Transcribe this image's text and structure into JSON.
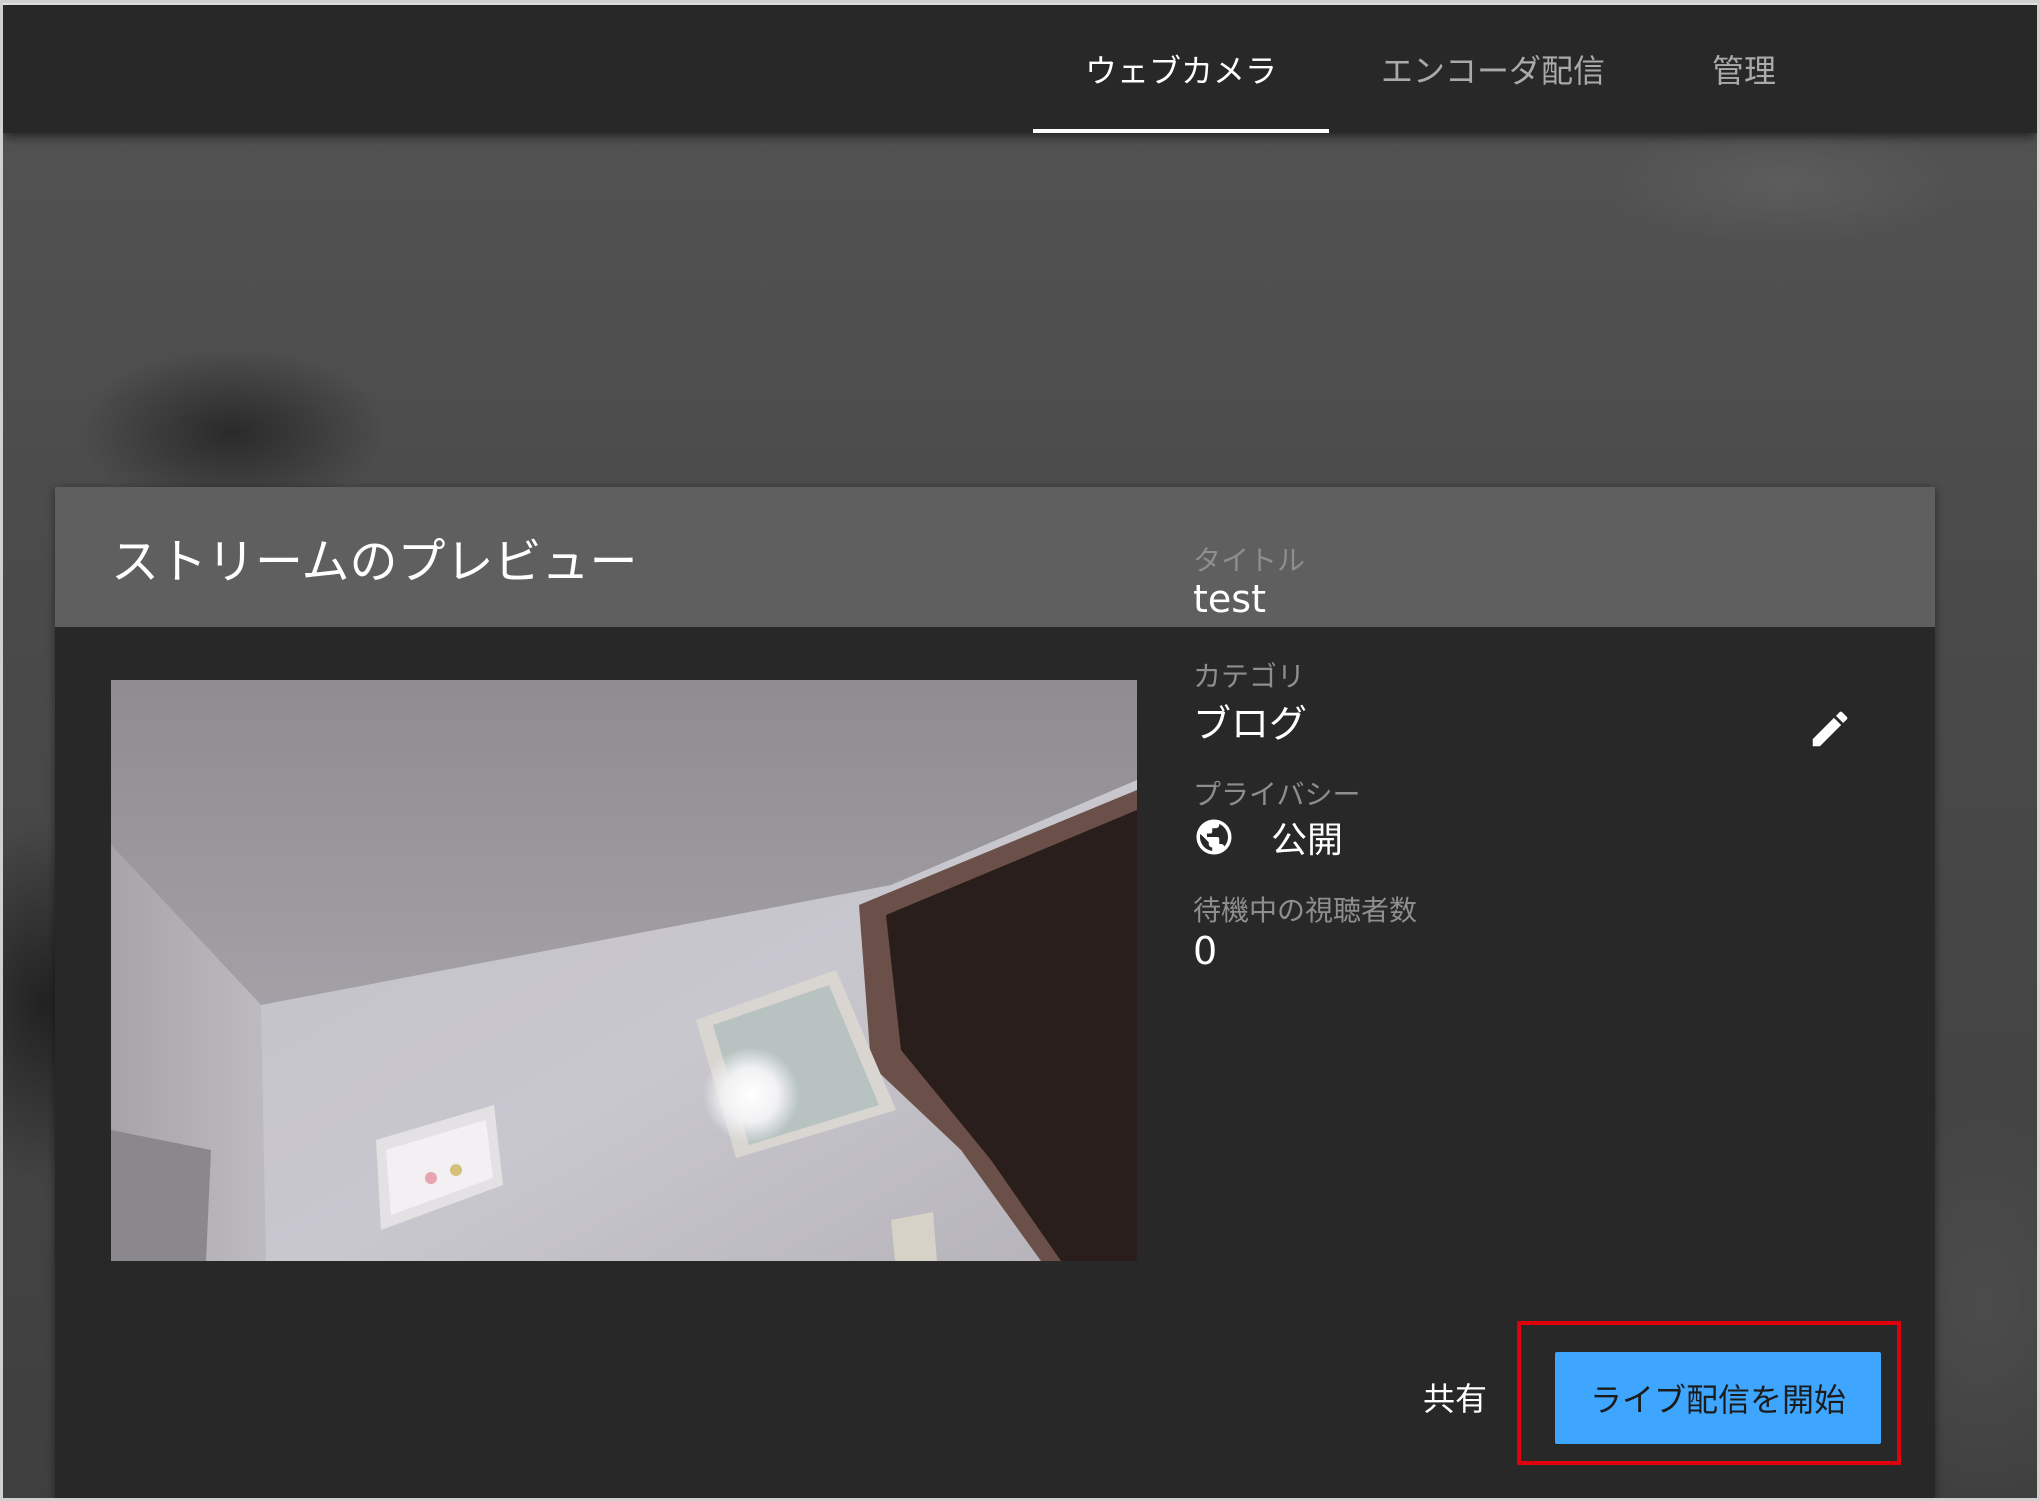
{
  "tabs": [
    {
      "label": "ウェブカメラ",
      "active": true
    },
    {
      "label": "エンコーダ配信",
      "active": false
    },
    {
      "label": "管理",
      "active": false
    }
  ],
  "card": {
    "title": "ストリームのプレビュー",
    "fields": {
      "title": {
        "label": "タイトル",
        "value": "test"
      },
      "category": {
        "label": "カテゴリ",
        "value": "ブログ"
      },
      "privacy": {
        "label": "プライバシー",
        "value": "公開",
        "icon": "globe-icon"
      },
      "waiting_viewers": {
        "label": "待機中の視聴者数",
        "value": "0"
      }
    },
    "edit_icon": "pencil-icon",
    "actions": {
      "share_label": "共有",
      "go_live_label": "ライブ配信を開始"
    }
  },
  "colors": {
    "header_bg": "#282828",
    "card_head_bg": "#5f5f5f",
    "card_bg": "#282828",
    "primary_button": "#3ea6ff",
    "highlight": "#e0000c"
  }
}
